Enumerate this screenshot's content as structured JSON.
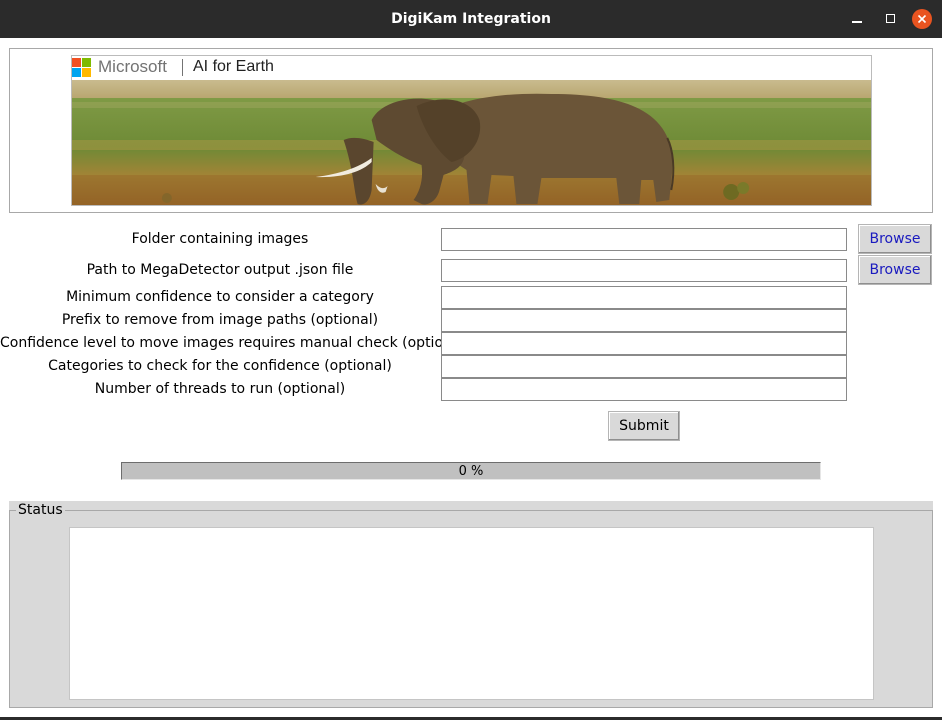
{
  "window": {
    "title": "DigiKam Integration",
    "controls": {
      "minimize_icon": "minimize-icon",
      "maximize_icon": "maximize-icon",
      "close_icon": "close-icon"
    }
  },
  "banner": {
    "brand": "Microsoft",
    "product": "AI for Earth",
    "image": "elephant-savanna-photo"
  },
  "form": {
    "fields": [
      {
        "label": "Folder containing images",
        "value": ""
      },
      {
        "label": "Path to MegaDetector output .json file",
        "value": ""
      },
      {
        "label": "Minimum confidence to consider a category",
        "value": ""
      },
      {
        "label": "Prefix to remove from image paths (optional)",
        "value": ""
      },
      {
        "label": "Confidence level to move images requires manual check (optional)",
        "value": ""
      },
      {
        "label": "Categories to check for the confidence (optional)",
        "value": ""
      },
      {
        "label": "Number of threads to run (optional)",
        "value": ""
      }
    ],
    "browse_label": "Browse",
    "submit_label": "Submit"
  },
  "progress": {
    "value": 0,
    "text": "0 %"
  },
  "status": {
    "legend": "Status",
    "text": ""
  },
  "colors": {
    "titlebar": "#2b2b2b",
    "close_button": "#e95420",
    "button_face": "#d9d9d9",
    "browse_text": "#1a1abf",
    "group_bg": "#d9d9d9"
  }
}
